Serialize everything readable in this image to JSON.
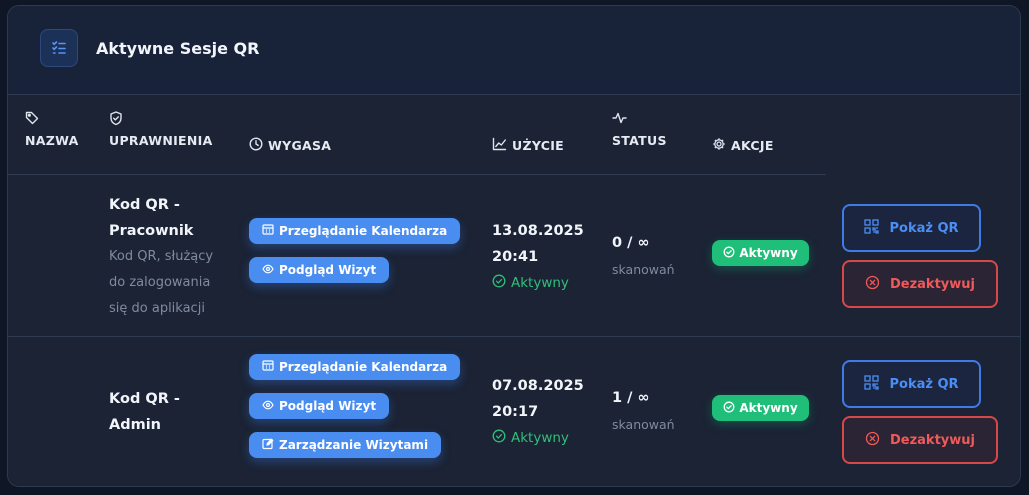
{
  "header": {
    "title": "Aktywne Sesje QR",
    "icon": "list-check-icon"
  },
  "columns": {
    "name": "NAZWA",
    "permissions": "UPRAWNIENIA",
    "expires": "WYGASA",
    "usage": "UŻYCIE",
    "status": "STATUS",
    "actions": "AKCJE"
  },
  "rows": [
    {
      "name": "Kod QR - Pracownik",
      "name_line1": "Kod QR -",
      "name_line2": "Pracownik",
      "desc_line1": "Kod QR, służący",
      "desc_line2": "do zalogowania",
      "desc_line3": "się do aplikacji",
      "permissions": [
        "Przeglądanie Kalendarza",
        "Podgląd Wizyt"
      ],
      "date": "13.08.2025",
      "time": "20:41",
      "expiry_state": "Aktywny",
      "usage": "0 / ∞",
      "usage_label": "skanowań",
      "status": "Aktywny",
      "show_qr": "Pokaż QR",
      "deactivate": "Dezaktywuj"
    },
    {
      "name_line1": "Kod QR -",
      "name_line2": "Admin",
      "permissions": [
        "Przeglądanie Kalendarza",
        "Podgląd Wizyt",
        "Zarządzanie Wizytami"
      ],
      "date": "07.08.2025",
      "time": "20:17",
      "expiry_state": "Aktywny",
      "usage": "1 / ∞",
      "usage_label": "skanowań",
      "status": "Aktywny",
      "show_qr": "Pokaż QR",
      "deactivate": "Dezaktywuj"
    }
  ],
  "colors": {
    "accent": "#4a8df0",
    "success": "#1fbf7a",
    "danger": "#d94848",
    "background": "#1b2334"
  }
}
